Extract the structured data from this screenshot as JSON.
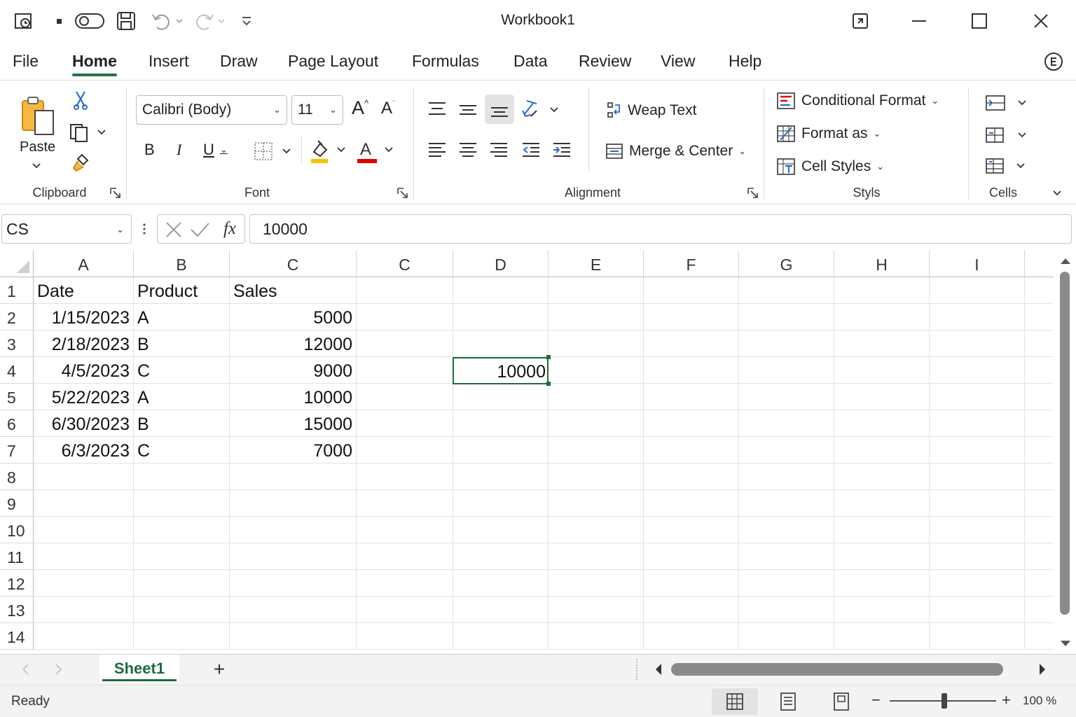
{
  "window": {
    "title": "Workbook1",
    "buttons": [
      "restore-down",
      "minimize",
      "maximize",
      "close"
    ]
  },
  "menu": {
    "tabs": [
      "File",
      "Home",
      "Insert",
      "Draw",
      "Page Layout",
      "Formulas",
      "Data",
      "Review",
      "View",
      "Help"
    ],
    "active": "Home"
  },
  "ribbon": {
    "clipboard": {
      "paste": "Paste",
      "label": "Clipboard"
    },
    "font": {
      "name": "Calibri (Body)",
      "size": "11",
      "label": "Font",
      "bold": "B",
      "italic": "I",
      "underline": "U",
      "grow": "A",
      "shrink": "A",
      "font_color_glyph": "A"
    },
    "alignment": {
      "wrap": "Weap Text",
      "merge": "Merge & Center",
      "label": "Alignment"
    },
    "styles": {
      "conditional": "Conditional Format",
      "format_as": "Format as",
      "cell_styles": "Cell Styles",
      "label": "Styls"
    },
    "cells": {
      "label": "Cells"
    }
  },
  "formula_bar": {
    "name_box": "CS",
    "formula": "10000",
    "fx": "fx"
  },
  "grid": {
    "columns": [
      "A",
      "B",
      "C",
      "C",
      "D",
      "E",
      "F",
      "G",
      "H",
      "I"
    ],
    "rows": [
      "1",
      "2",
      "3",
      "4",
      "5",
      "6",
      "7",
      "8",
      "9",
      "10",
      "11",
      "12",
      "13",
      "14"
    ],
    "header_row": {
      "a": "Date",
      "b": "Product",
      "c": "Sales"
    },
    "data": [
      {
        "date": "1/15/2023",
        "product": "A",
        "sales": "5000"
      },
      {
        "date": "2/18/2023",
        "product": "B",
        "sales": "12000"
      },
      {
        "date": "4/5/2023",
        "product": "C",
        "sales": "9000"
      },
      {
        "date": "5/22/2023",
        "product": "A",
        "sales": "10000"
      },
      {
        "date": "6/30/2023",
        "product": "B",
        "sales": "15000"
      },
      {
        "date": "6/3/2023",
        "product": "C",
        "sales": "7000"
      }
    ],
    "selected_value": "10000"
  },
  "sheets": {
    "tabs": [
      "Sheet1"
    ],
    "add": "+"
  },
  "status": {
    "text": "Ready",
    "zoom": "100 %",
    "zoom_minus": "−",
    "zoom_plus": "+"
  },
  "colors": {
    "accent": "#217346",
    "selection": "#1e6b3e",
    "highlight_yellow": "#f2c500",
    "font_red": "#e00000"
  }
}
